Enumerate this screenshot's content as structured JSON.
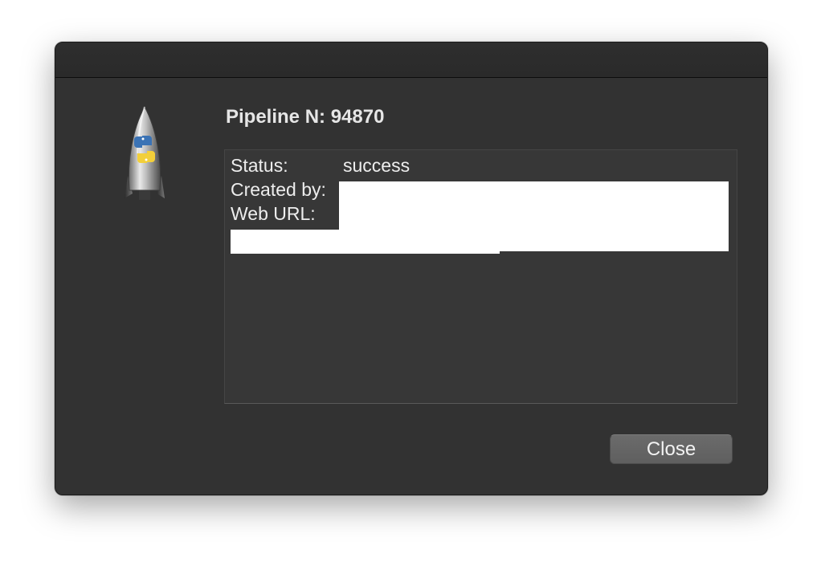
{
  "dialog": {
    "heading": "Pipeline N: 94870",
    "icon": "python-rocket-icon",
    "rows": [
      {
        "label": "Status:",
        "value": "success"
      },
      {
        "label": "Created by:",
        "value": ""
      },
      {
        "label": "Web URL:",
        "value": ""
      }
    ],
    "close_label": "Close"
  },
  "colors": {
    "window_bg": "#323232",
    "info_bg": "#373737",
    "button_bg": "#666666",
    "text": "#ededed",
    "redaction": "#ffffff"
  }
}
